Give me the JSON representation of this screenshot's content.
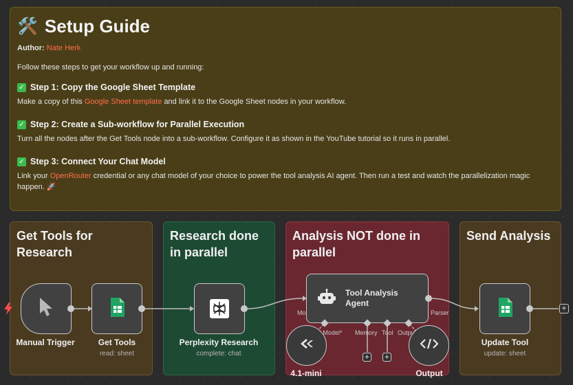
{
  "setup": {
    "icon": "🛠️",
    "title": "Setup Guide",
    "author_label": "Author:",
    "author_name": "Nate Herk",
    "intro": "Follow these steps to get your workflow up and running:",
    "step1_title": "Step 1: Copy the Google Sheet Template",
    "step1_pre": "Make a copy of this ",
    "step1_link": "Google Sheet template",
    "step1_post": " and link it to the Google Sheet nodes in your workflow.",
    "step2_title": "Step 2: Create a Sub-workflow for Parallel Execution",
    "step2_text": "Turn all the nodes after the Get Tools node into a sub-workflow. Configure it as shown in the YouTube tutorial so it runs in parallel.",
    "step3_title": "Step 3: Connect Your Chat Model",
    "step3_pre": "Link your ",
    "step3_link": "OpenRouter",
    "step3_post": " credential or any chat model of your choice to power the tool analysis AI agent. Then run a test and watch the parallelization magic happen. 🚀",
    "check": "✓"
  },
  "sections": {
    "s1": "Get Tools for Research",
    "s2": "Research done in parallel",
    "s3": "Analysis NOT done in parallel",
    "s4": "Send Analysis"
  },
  "nodes": {
    "trigger_label": "Manual Trigger",
    "get_tools_label": "Get Tools",
    "get_tools_sub": "read: sheet",
    "perplexity_label": "Perplexity Research",
    "perplexity_sub": "complete: chat",
    "agent_label": "Tool Analysis Agent",
    "model_label": "4.1-mini",
    "output_label": "Output",
    "update_label": "Update Tool",
    "update_sub": "update: sheet",
    "chat_model_port": "Chat Model*",
    "memory_port": "Memory",
    "tool_port": "Tool",
    "parser_port": "Output Parser",
    "left_port_stub": "Mo",
    "right_port_stub": "Parser",
    "plus": "+"
  },
  "colors": {
    "setup_bg": "#4a3e18",
    "brown_bg": "#4a3a20",
    "green_bg": "#1d4a33",
    "red_bg": "#6a2730",
    "link": "#ff6d4a",
    "sheets_green": "#1fa463",
    "trigger_bolt": "#ff4d4d"
  },
  "icons": [
    "tools-icon",
    "cursor-icon",
    "google-sheets-icon",
    "perplexity-icon",
    "robot-icon",
    "openai-icon",
    "code-icon",
    "bolt-icon",
    "plus-icon"
  ]
}
